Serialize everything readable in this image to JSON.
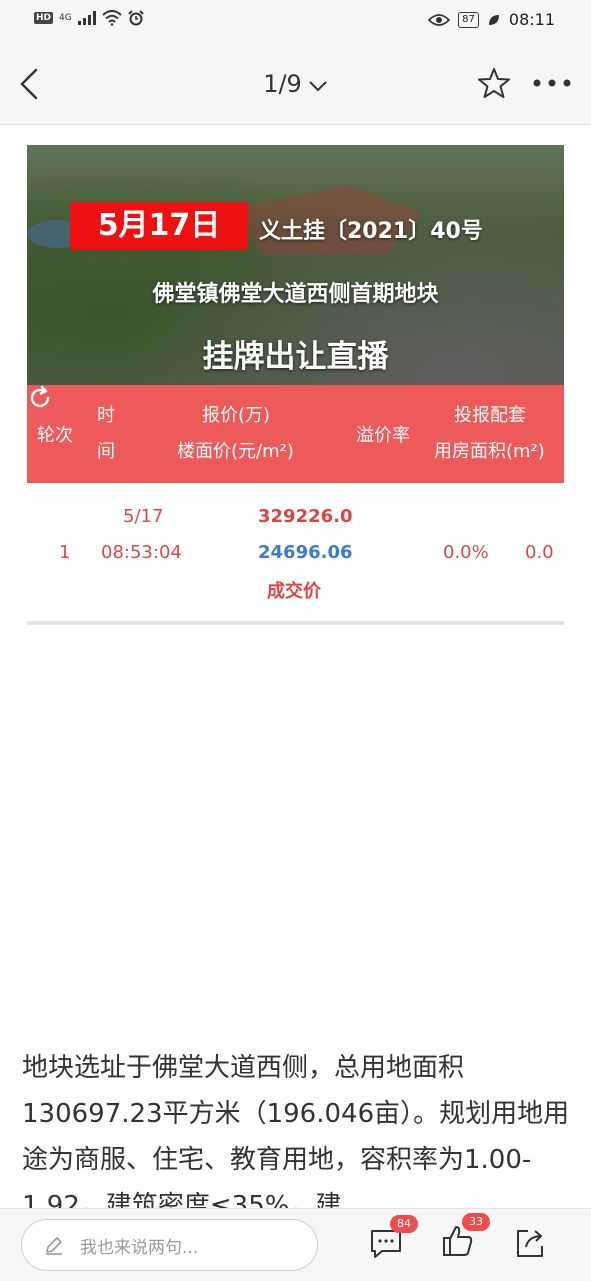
{
  "status_bar": {
    "network_hd": "HD",
    "network_gen": "4G",
    "battery": "87",
    "time": "08:11"
  },
  "nav": {
    "page_indicator": "1/9"
  },
  "banner": {
    "date": "5月17日",
    "doc_number": "义土挂〔2021〕40号",
    "site": "佛堂镇佛堂大道西侧首期地块",
    "live": "挂牌出让直播"
  },
  "table": {
    "headers": {
      "round": "轮次",
      "time_line1": "时",
      "time_line2": "间",
      "price_line1": "报价(万)",
      "price_line2": "楼面价(元/m²)",
      "premium": "溢价率",
      "support_line1": "投报配套",
      "support_line2": "用房面积(m²)"
    },
    "rows": [
      {
        "round": "1",
        "date": "5/17",
        "time": "08:53:04",
        "total_price": "329226.0",
        "unit_price": "24696.06",
        "deal_label": "成交价",
        "premium": "0.0%",
        "area": "0.0"
      }
    ]
  },
  "article": {
    "text": "地块选址于佛堂大道西侧，总用地面积130697.23平方米（196.046亩）。规划用地用途为商服、住宅、教育用地，容积率为1.00-1.92，建筑密度≤35%，建"
  },
  "bottom_bar": {
    "comment_placeholder": "我也来说两句...",
    "comments_count": "84",
    "likes_count": "33"
  },
  "colors": {
    "accent_red": "#ee5a5a",
    "price_red": "#e04343",
    "price_blue": "#3a7bd5"
  }
}
